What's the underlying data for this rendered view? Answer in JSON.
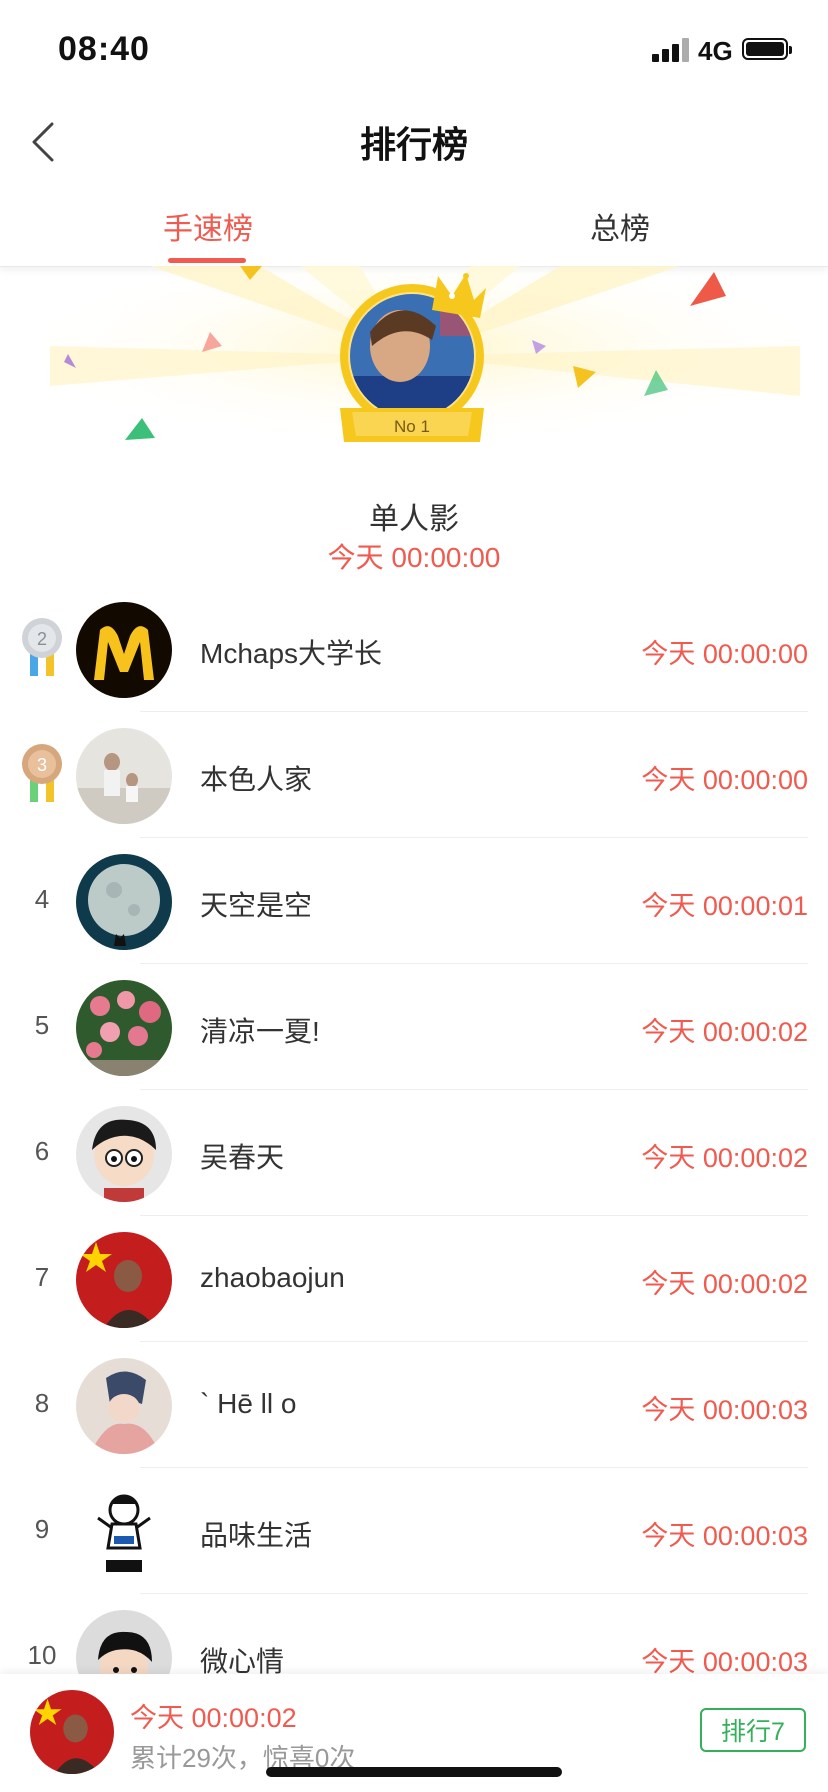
{
  "status_bar": {
    "time": "08:40",
    "network": "4G"
  },
  "nav": {
    "title": "排行榜"
  },
  "tabs": [
    {
      "label": "手速榜",
      "active": true
    },
    {
      "label": "总榜",
      "active": false
    }
  ],
  "champion": {
    "badge": "No 1",
    "name": "单人影",
    "time": "今天 00:00:00"
  },
  "ranking": [
    {
      "rank": "2",
      "name": "Mchaps大学长",
      "time": "今天 00:00:00",
      "medal": "silver"
    },
    {
      "rank": "3",
      "name": "本色人家",
      "time": "今天 00:00:00",
      "medal": "bronze"
    },
    {
      "rank": "4",
      "name": "天空是空",
      "time": "今天 00:00:01"
    },
    {
      "rank": "5",
      "name": "清凉一夏!",
      "time": "今天 00:00:02"
    },
    {
      "rank": "6",
      "name": "吴春天",
      "time": "今天 00:00:02"
    },
    {
      "rank": "7",
      "name": "zhaobaojun",
      "time": "今天 00:00:02"
    },
    {
      "rank": "8",
      "name": "` Hē ll o",
      "time": "今天 00:00:03"
    },
    {
      "rank": "9",
      "name": "品味生活",
      "time": "今天 00:00:03"
    },
    {
      "rank": "10",
      "name": "微心情",
      "time": "今天 00:00:03"
    }
  ],
  "footer": {
    "my_time": "今天 00:00:02",
    "my_stats": "累计29次，惊喜0次",
    "rank_button": "排行7"
  },
  "colors": {
    "accent": "#f05a4f",
    "green": "#34b05a"
  },
  "icons": {
    "back": "chevron-left-icon",
    "crown": "crown-icon",
    "medal_2": "silver-medal-icon",
    "medal_3": "bronze-medal-icon"
  }
}
